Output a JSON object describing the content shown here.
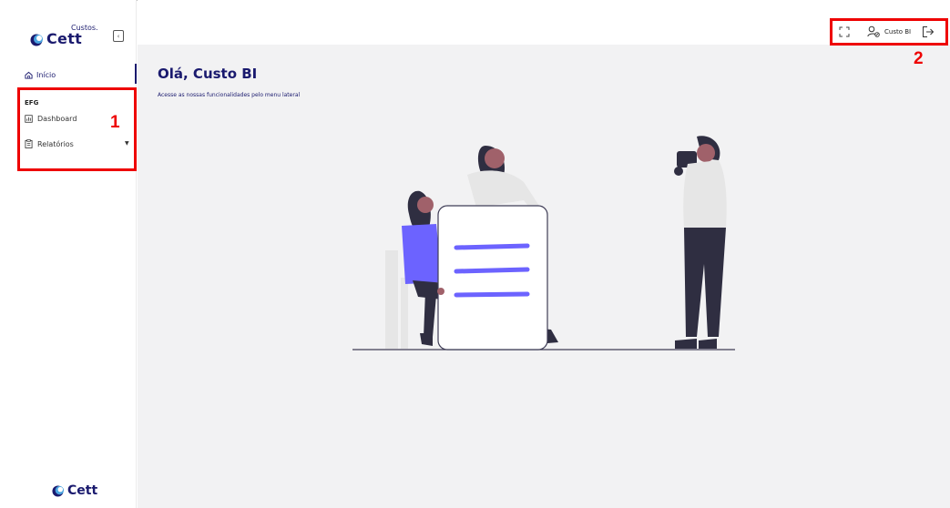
{
  "sidebar": {
    "logo_small": "Custos.",
    "logo_big": "Cett",
    "collapse_icon": "panel-collapse-icon",
    "home_label": "Início",
    "section_label": "EFG",
    "items": [
      {
        "label": "Dashboard",
        "icon": "dashboard-icon"
      },
      {
        "label": "Relatórios",
        "icon": "report-icon"
      }
    ],
    "footer_logo": "Cett"
  },
  "header": {
    "user_name": "Custo BI",
    "icons": [
      "fullscreen-icon",
      "user-settings-icon",
      "logout-icon"
    ]
  },
  "main": {
    "title": "Olá, Custo BI",
    "subtitle": "Acesse as nossas funcionalidades pelo menu lateral"
  },
  "annotations": {
    "box1": "1",
    "box2": "2"
  },
  "colors": {
    "brand": "#1a1a6e",
    "accent": "#6c63ff",
    "annotation": "#ee0000",
    "background": "#f2f2f3"
  }
}
